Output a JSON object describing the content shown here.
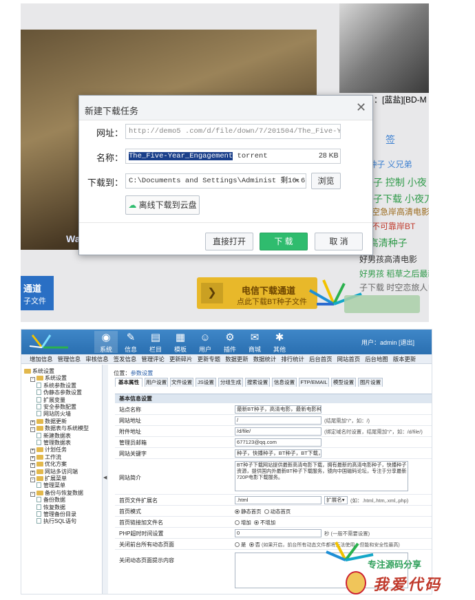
{
  "dialog": {
    "title": "新建下载任务",
    "url_label": "网址：",
    "url_value": "http://demo5          .com/d/file/down/7/201504/The_Five-Yea",
    "name_label": "名称：",
    "name_selected": "The_Five-Year_Engagement",
    "name_rest": " torrent",
    "size": "28 KB",
    "saveto_label": "下载到：",
    "saveto_value": "C:\\Documents and Settings\\Administ",
    "free_space": "剩16.6 GB",
    "browse_label": "浏览",
    "cloud_label": "离线下载到云盘",
    "open_label": "直接打开",
    "download_label": "下 载",
    "cancel_label": "取 消"
  },
  "page_bg": {
    "side_caption": "片：[蓝盐][BD-M",
    "video_text": "Wa",
    "tags": [
      {
        "text": "签",
        "color": "#3b7fd0"
      },
      {
        "text": "T种子  义兄弟",
        "color": "#3b7fd0"
      },
      {
        "text": "种子  控制  小夜",
        "color": "#2f9a49"
      },
      {
        "text": "种子下载  小夜刀",
        "color": "#2f9a49"
      },
      {
        "text": "时空急岸高清电影",
        "color": "#9b6a1a"
      },
      {
        "text": "，不可靠岸BT",
        "color": "#c0392b"
      },
      {
        "text": "3高清种子",
        "color": "#2f9a49"
      },
      {
        "text": "好男孩高清电影",
        "color": "#333333"
      },
      {
        "text": "好男孩  稻草之后最新电影",
        "color": "#2f9a49"
      },
      {
        "text": "子下载  时空恋旅人电影",
        "color": "#666666"
      }
    ],
    "dl_left_a": "通道",
    "dl_left_b": "子文件",
    "dl_right_a": "电信下载通道",
    "dl_right_b": "点此下载BT种子文件"
  },
  "cms": {
    "nav": [
      {
        "label": "系统",
        "icon": "◉"
      },
      {
        "label": "信息",
        "icon": "✎"
      },
      {
        "label": "栏目",
        "icon": "▤"
      },
      {
        "label": "模板",
        "icon": "▦"
      },
      {
        "label": "用户",
        "icon": "☺"
      },
      {
        "label": "插件",
        "icon": "⚙"
      },
      {
        "label": "商城",
        "icon": "✉"
      },
      {
        "label": "其他",
        "icon": "✱"
      }
    ],
    "user_info": "用户：admin [退出]",
    "subnav": [
      "增加信息",
      "管理信息",
      "审核信息",
      "签发信息",
      "管理评论",
      "更新碎片",
      "更新专题",
      "数据更新",
      "数据统计",
      "排行统计",
      "后台首页",
      "网站首页",
      "后台地图",
      "版本更新"
    ],
    "tree": [
      {
        "text": "系统设置",
        "level": 0,
        "type": "root"
      },
      {
        "text": "系统设置",
        "level": 1,
        "type": "folder",
        "pm": "-"
      },
      {
        "text": "系统参数设置",
        "level": 2,
        "type": "doc"
      },
      {
        "text": "伪静态参数设置",
        "level": 2,
        "type": "doc"
      },
      {
        "text": "扩展变量",
        "level": 2,
        "type": "doc"
      },
      {
        "text": "安全参数配置",
        "level": 2,
        "type": "doc"
      },
      {
        "text": "网站防火墙",
        "level": 2,
        "type": "doc"
      },
      {
        "text": "数据更新",
        "level": 1,
        "type": "folder",
        "pm": "+"
      },
      {
        "text": "数据表与系统模型",
        "level": 1,
        "type": "folder",
        "pm": "-"
      },
      {
        "text": "新建数据表",
        "level": 2,
        "type": "doc"
      },
      {
        "text": "管理数据表",
        "level": 2,
        "type": "doc"
      },
      {
        "text": "计划任务",
        "level": 1,
        "type": "folder",
        "pm": "+"
      },
      {
        "text": "工作流",
        "level": 1,
        "type": "folder",
        "pm": "+"
      },
      {
        "text": "优化方案",
        "level": 1,
        "type": "folder",
        "pm": "+"
      },
      {
        "text": "网站多访问端",
        "level": 1,
        "type": "folder",
        "pm": "+"
      },
      {
        "text": "扩展菜单",
        "level": 1,
        "type": "folder",
        "pm": "-"
      },
      {
        "text": "管理菜单",
        "level": 2,
        "type": "doc"
      },
      {
        "text": "备份与恢复数据",
        "level": 1,
        "type": "folder",
        "pm": "-"
      },
      {
        "text": "备份数据",
        "level": 2,
        "type": "doc"
      },
      {
        "text": "恢复数据",
        "level": 2,
        "type": "doc"
      },
      {
        "text": "管理备份目录",
        "level": 2,
        "type": "doc"
      },
      {
        "text": "执行SQL语句",
        "level": 2,
        "type": "doc"
      }
    ],
    "location_prefix": "位置：",
    "location_link": "参数设置",
    "tabs": [
      "基本属性",
      "用户设置",
      "文件设置",
      "JS设置",
      "分组生成",
      "搜索设置",
      "信息设置",
      "FTP/EMAIL",
      "模型设置",
      "图片设置"
    ],
    "section_title": "基本信息设置",
    "fields": {
      "site_name_label": "站点名称",
      "site_name_value": "最新BT种子，高清电影，最新电影种子",
      "site_url_label": "网站地址",
      "site_url_value": "/",
      "site_url_hint": "(结尾需加\"/\"，如：/)",
      "attach_label": "附件地址",
      "attach_value": "/d/file/",
      "attach_hint": "(绑定域名时设置，结尾需加\"/\"，如：/d/file/)",
      "email_label": "管理员邮箱",
      "email_value": "677123@qq.com",
      "keywords_label": "网站关键字",
      "keywords_value": "种子，快播种子，BT种子，BT下载，最",
      "intro_label": "网站简介",
      "intro_value": "BT种子下载网站提供最新高清电影下载，拥有最新的高清电影种子，快播种子资源，提供国内外最新BT种子下载服务，镜向中国磁码论坛，专注于分享最新720P电影下载服务。",
      "ext_label": "首页文件扩展名",
      "ext_value": ".html",
      "ext_select": "扩展名",
      "ext_hint": "(如：.html,.htm,.xml,.php)",
      "mode_label": "首页模式",
      "mode_opt1": "静态首页",
      "mode_opt2": "动态首页",
      "link_label": "首页链接加文件名",
      "link_opt1": "增加",
      "link_opt2": "不增加",
      "php_label": "PHP超时时间设置",
      "php_value": "0",
      "php_hint": "秒 (一般不需要设置)",
      "close_label": "关闭前台所有动态页面",
      "close_opt1": "是",
      "close_opt2": "否",
      "close_hint": "(如果开启，前台所有动态文件都将无法使用，但能和安全性最高)",
      "closemsg_label": "关闭动态页面提示内容"
    }
  },
  "watermark": {
    "line1": "专注源码分享",
    "line2": "我爱代码"
  }
}
